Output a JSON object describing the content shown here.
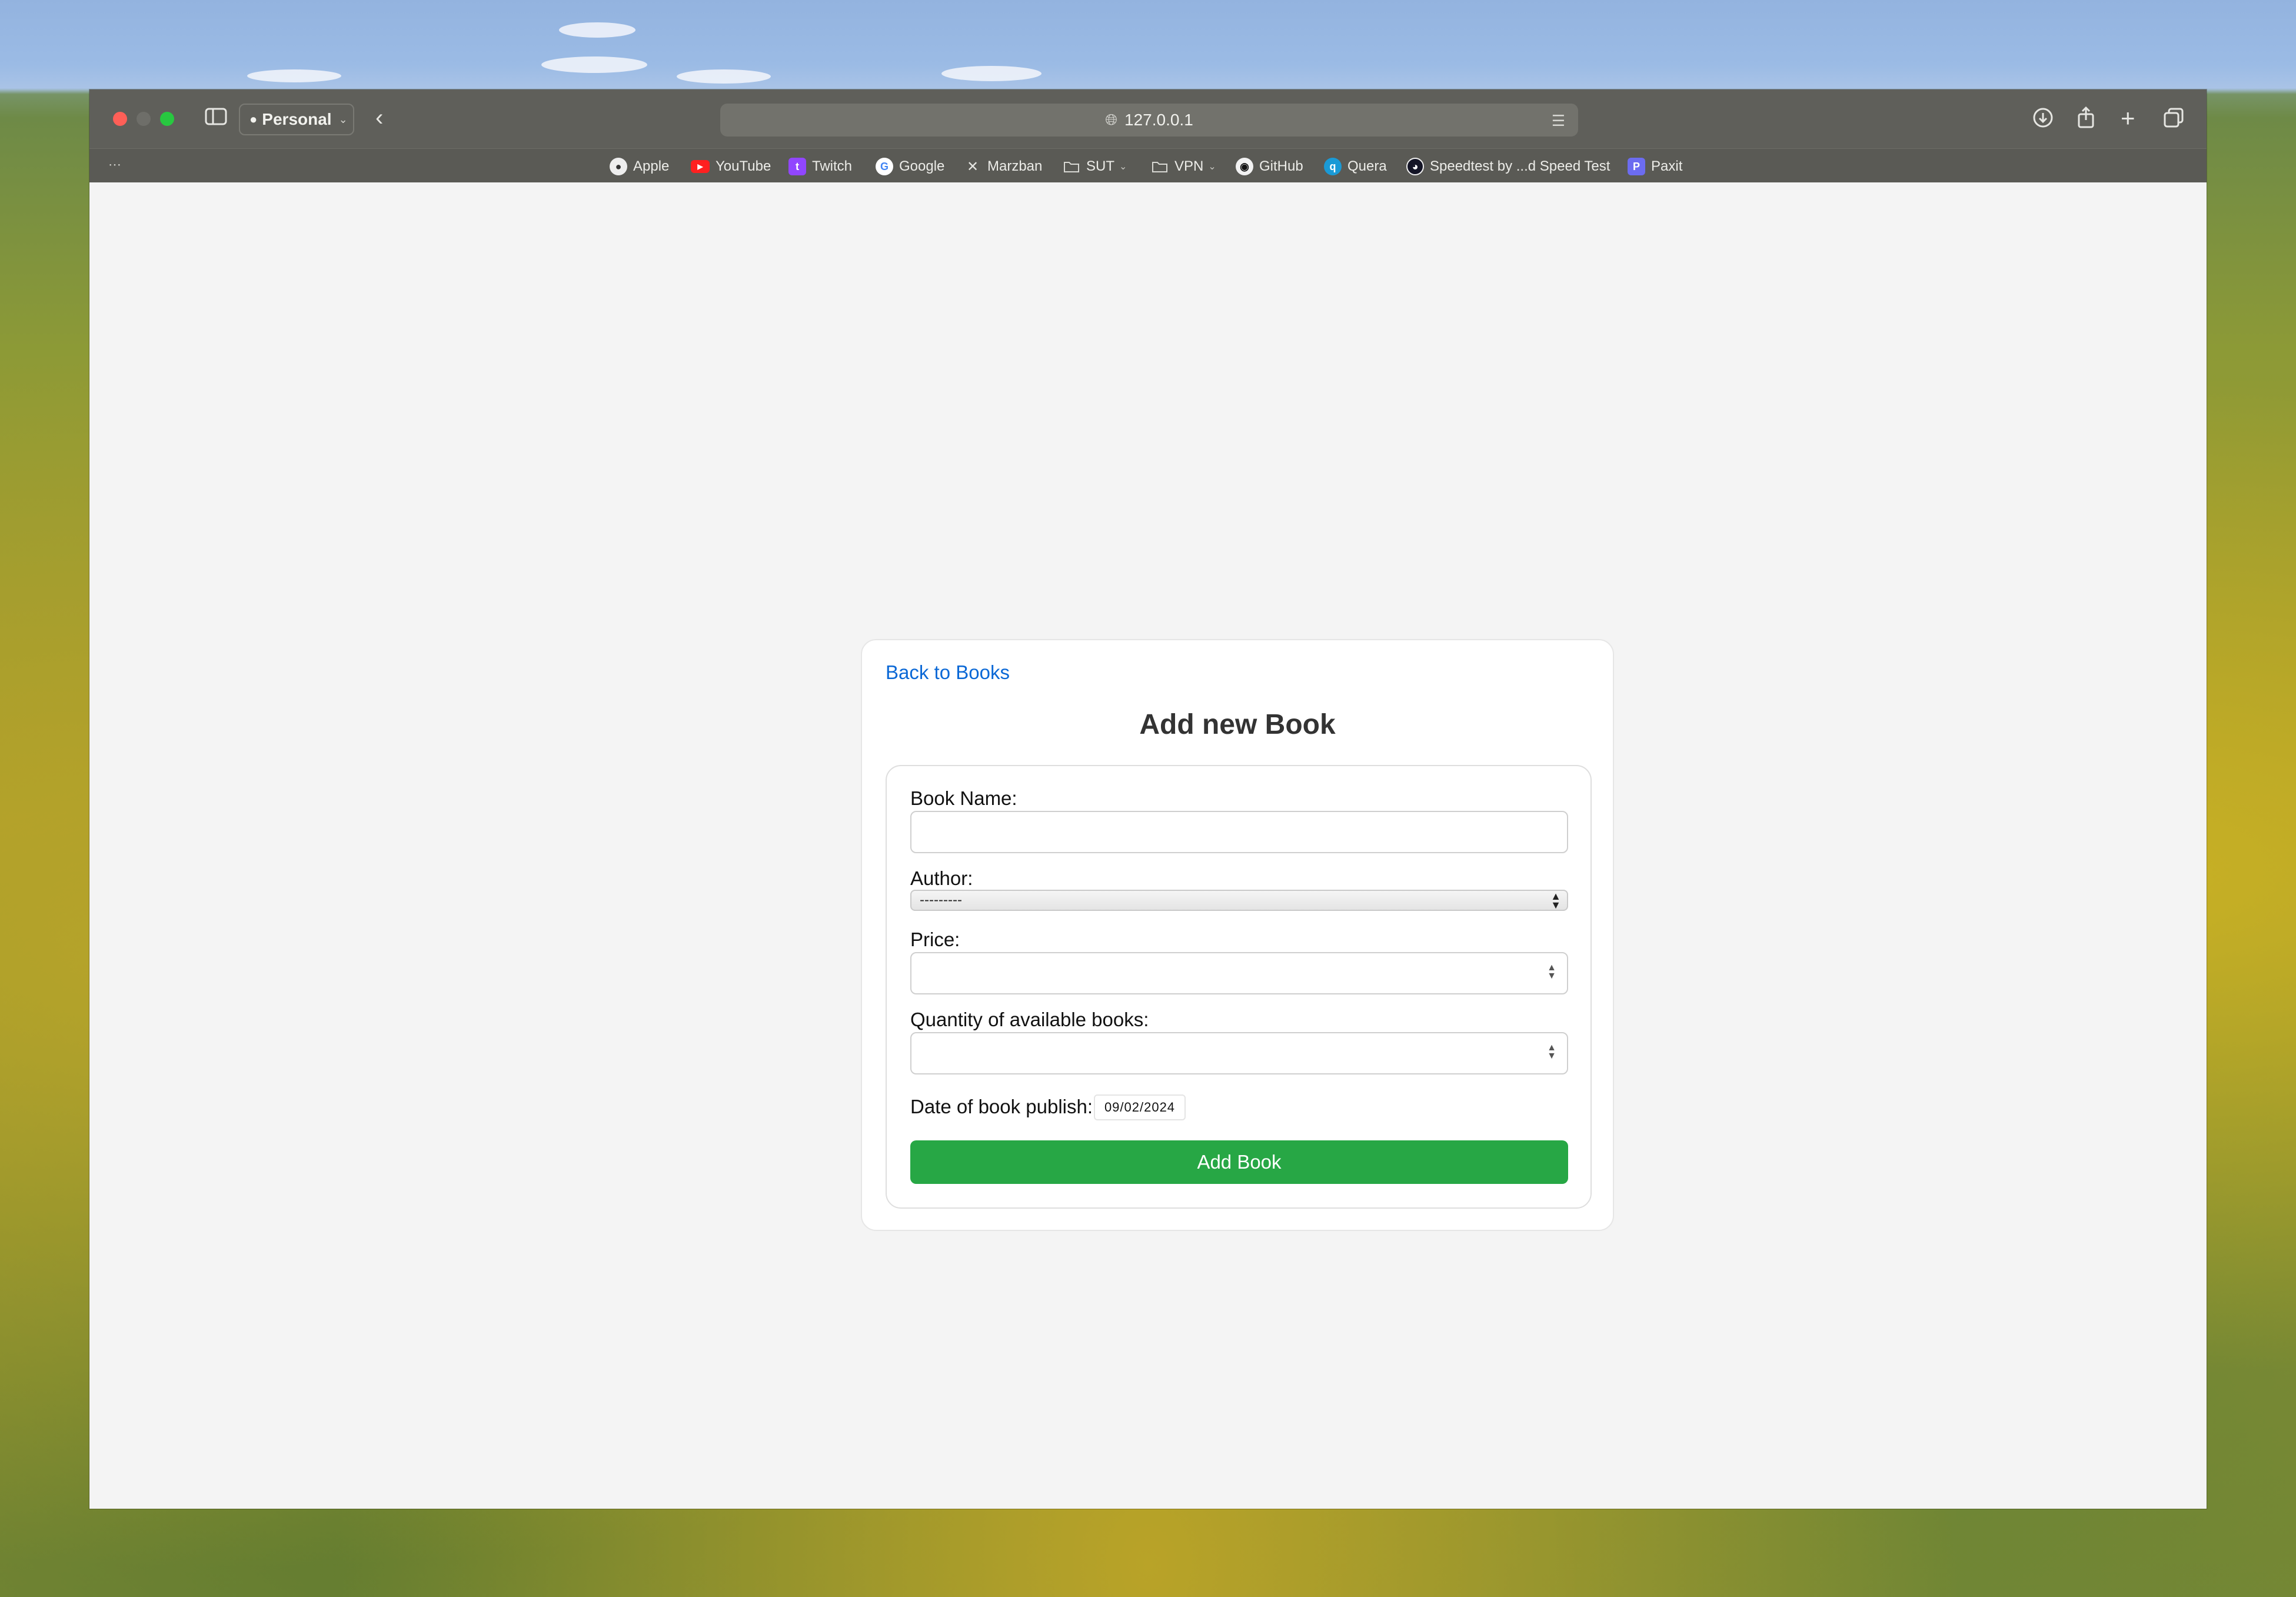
{
  "browser": {
    "profile_label": "Personal",
    "address": "127.0.0.1",
    "bookmarks": [
      {
        "label": "Apple",
        "icon": "apple-icon"
      },
      {
        "label": "YouTube",
        "icon": "youtube-icon"
      },
      {
        "label": "Twitch",
        "icon": "twitch-icon"
      },
      {
        "label": "Google",
        "icon": "google-icon"
      },
      {
        "label": "Marzban",
        "icon": "marzban-icon"
      },
      {
        "label": "SUT",
        "icon": "folder-icon"
      },
      {
        "label": "VPN",
        "icon": "folder-icon"
      },
      {
        "label": "GitHub",
        "icon": "github-icon"
      },
      {
        "label": "Quera",
        "icon": "quera-icon"
      },
      {
        "label": "Speedtest by ...d Speed Test",
        "icon": "speedtest-icon"
      },
      {
        "label": "Paxit",
        "icon": "paxit-icon"
      }
    ]
  },
  "page": {
    "back_link": "Back to Books",
    "title": "Add new Book",
    "form": {
      "book_name_label": "Book Name:",
      "book_name_value": "",
      "author_label": "Author:",
      "author_selected": "---------",
      "price_label": "Price:",
      "price_value": "",
      "quantity_label": "Quantity of available books:",
      "quantity_value": "",
      "date_label": "Date of book publish:",
      "date_value": "09/02/2024",
      "submit_label": "Add Book"
    }
  },
  "colors": {
    "accent_link": "#0a68d6",
    "submit_button": "#27a745",
    "page_background": "#f4f4f4"
  }
}
